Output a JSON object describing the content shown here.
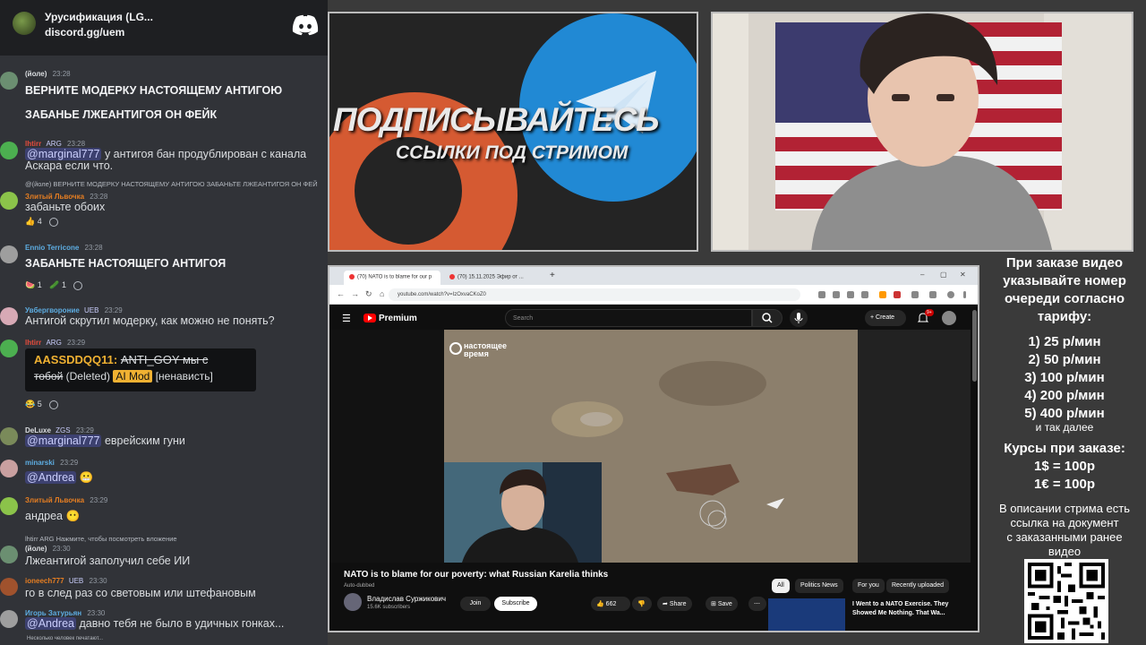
{
  "discord": {
    "server_name": "Урусификация (LG...",
    "server_link": "discord.gg/uem",
    "typing": "Несколько человек печатают..."
  },
  "messages": [
    {
      "user": "(йоле)",
      "time": "23:28",
      "lines": [
        "ВЕРНИТЕ МОДЕРКУ НАСТОЯЩЕМУ АНТИГОЮ",
        "ЗАБАНЬЕ ЛЖЕАНТИГОЯ ОН ФЕЙК"
      ]
    },
    {
      "user": "lhtirr",
      "badge": "ARG",
      "time": "23:28",
      "mention": "@marginal777",
      "text": " у антигоя бан продублирован с канала",
      "text2": "Аскара если что."
    },
    {
      "reply": "@(йоле) ВЕРНИТЕ МОДЕРКУ НАСТОЯЩЕМУ АНТИГОЮ    ЗАБАНЬТЕ ЛЖЕАНТИГОЯ ОН ФЕЙ",
      "user": "Злитый Львочка",
      "time": "23:28",
      "text": "забаньте обоих",
      "reacts": [
        "👍 4"
      ]
    },
    {
      "user": "Ennio Terricone",
      "time": "23:28",
      "text": "ЗАБАНЬТЕ НАСТОЯЩЕГО АНТИГОЯ",
      "reacts": [
        "🍉 1",
        "🥒 1"
      ]
    },
    {
      "user": "Увбергвороние",
      "badge": "UEB",
      "time": "23:29",
      "text": "Антигой скрутил модерку, как можно не понять?"
    },
    {
      "user": "lhtirr",
      "badge": "ARG",
      "time": "23:29",
      "embed_user": "AASSDDQQ11",
      "embed_strike1": "ANTI_GOY мы с",
      "embed_strike2": "тобой",
      "embed_deleted": "(Deleted)",
      "embed_aimod": "AI Mod",
      "embed_tag": "[ненависть]",
      "reacts": [
        "😂 5"
      ]
    },
    {
      "user": "DeLuxe",
      "badge": "ZGS",
      "time": "23:29",
      "mention": "@marginal777",
      "text": " еврейским гуни"
    },
    {
      "user": "minarski",
      "time": "23:29",
      "mention": "@Andrea",
      "text": ""
    },
    {
      "user": "Злитый Львочка",
      "time": "23:29",
      "text": "андреа"
    },
    {
      "reply": "lhtirr ARG Нажмите, чтобы посмотреть вложение",
      "user": "(йоле)",
      "time": "23:30",
      "text": "Лжеантигой заполучил себе ИИ"
    },
    {
      "user": "ioneech777",
      "badge": "UEB",
      "time": "23:30",
      "text": "го в след раз со световым или штефановым"
    },
    {
      "user": "Игорь Затурьян",
      "time": "23:30",
      "mention": "@Andrea",
      "text": " давно тебя не было в удичных гонках..."
    }
  ],
  "promo": {
    "title": "ПОДПИСЫВАЙТЕСЬ",
    "subtitle": "ССЫЛКИ ПОД СТРИМОМ"
  },
  "browser": {
    "tab1": "(70) NATO is to blame for our p",
    "tab2": "(70) 15.11.2025 Эфир от ...",
    "url": "youtube.com/watch?v=IzOxvaCKoZ0",
    "yt_brand": "Premium",
    "search_placeholder": "Search",
    "create": "Create",
    "notif_count": "9+",
    "video_logo_line1": "настоящее",
    "video_logo_line2": "время",
    "video_title": "NATO is to blame for our poverty: what Russian Karelia thinks",
    "auto_dubbed": "Auto-dubbed",
    "channel_name": "Владислав Суржикович",
    "channel_subs": "15.6K subscribers",
    "join": "Join",
    "subscribe": "Subscribe",
    "likes": "662",
    "share": "Share",
    "save": "Save",
    "chips": [
      "All",
      "Politics News",
      "For you",
      "Recently uploaded"
    ],
    "rec_title": "I Went to a NATO Exercise. They Showed Me Nothing. That Wa..."
  },
  "info": {
    "intro": [
      "При заказе видео",
      "указывайте номер",
      "очереди согласно",
      "тарифу:"
    ],
    "tariffs": [
      "1) 25 р/мин",
      "2) 50 р/мин",
      "3) 100 р/мин",
      "4) 200 р/мин",
      "5) 400 р/мин"
    ],
    "and_more": "и так далее",
    "rates_title": "Курсы при заказе:",
    "rates": [
      "1$ = 100р",
      "1€ = 100р"
    ],
    "desc": [
      "В описании стрима есть",
      "ссылка на документ",
      "с заказанными ранее",
      "видео"
    ]
  },
  "colors": {
    "discord_bg": "#313338",
    "discord_header": "#1e1f22",
    "mention": "#c9cdfb",
    "ai_mod": "#f0b132",
    "telegram": "#2189d4",
    "patreon": "#d55a32",
    "youtube_red": "#ff0000"
  }
}
